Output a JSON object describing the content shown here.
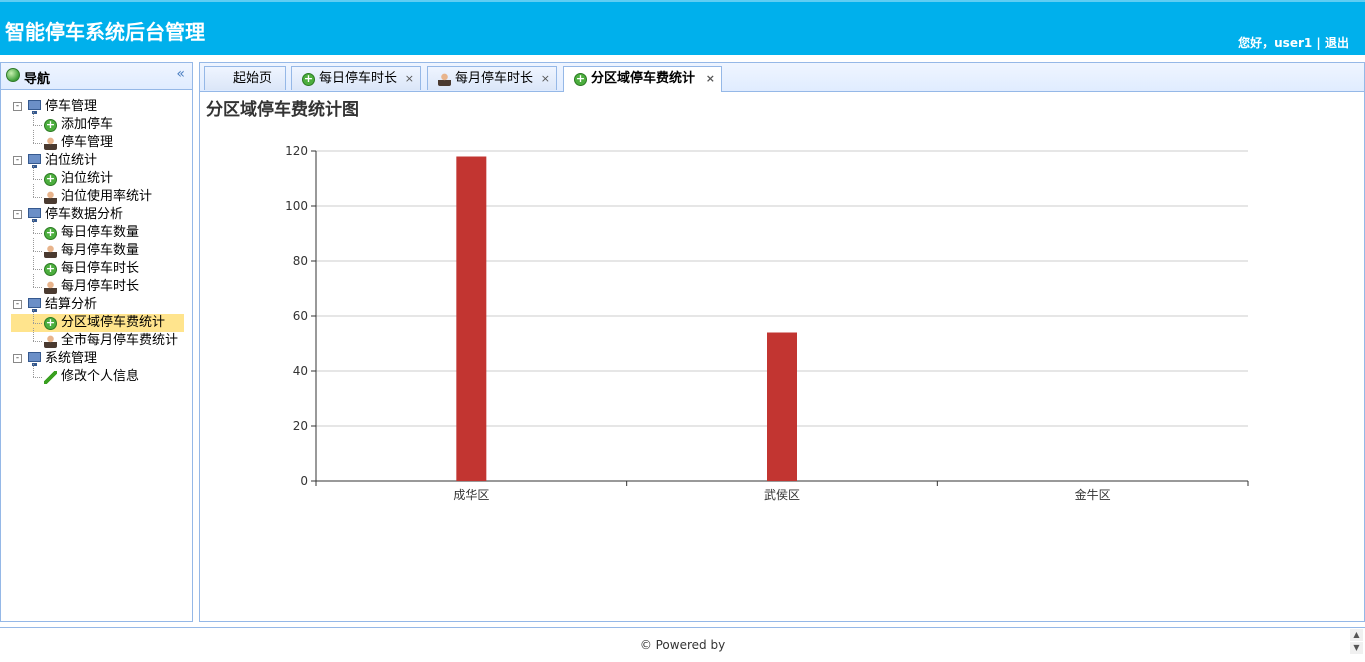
{
  "header": {
    "title": "智能停车系统后台管理",
    "greeting": "您好，user1",
    "separator": " | ",
    "logout": "退出"
  },
  "nav": {
    "title": "导航",
    "collapse_icon": "«",
    "groups": [
      {
        "label": "停车管理",
        "items": [
          {
            "label": "添加停车",
            "icon": "plus-icon"
          },
          {
            "label": "停车管理",
            "icon": "user-icon"
          }
        ]
      },
      {
        "label": "泊位统计",
        "items": [
          {
            "label": "泊位统计",
            "icon": "plus-icon"
          },
          {
            "label": "泊位使用率统计",
            "icon": "user-icon"
          }
        ]
      },
      {
        "label": "停车数据分析",
        "items": [
          {
            "label": "每日停车数量",
            "icon": "plus-icon"
          },
          {
            "label": "每月停车数量",
            "icon": "user-icon"
          },
          {
            "label": "每日停车时长",
            "icon": "plus-icon"
          },
          {
            "label": "每月停车时长",
            "icon": "user-icon"
          }
        ]
      },
      {
        "label": "结算分析",
        "items": [
          {
            "label": "分区域停车费统计",
            "icon": "plus-icon",
            "selected": true
          },
          {
            "label": "全市每月停车费统计",
            "icon": "user-icon"
          }
        ]
      },
      {
        "label": "系统管理",
        "items": [
          {
            "label": "修改个人信息",
            "icon": "pencil-icon"
          }
        ]
      }
    ]
  },
  "tabs": [
    {
      "label": "起始页",
      "closable": false,
      "icon": ""
    },
    {
      "label": "每日停车时长",
      "closable": true,
      "icon": "plus-icon"
    },
    {
      "label": "每月停车时长",
      "closable": true,
      "icon": "user-icon"
    },
    {
      "label": "分区域停车费统计",
      "closable": true,
      "icon": "plus-icon",
      "active": true
    }
  ],
  "tab_close_glyph": "×",
  "page_title": "分区域停车费统计图",
  "chart_data": {
    "type": "bar",
    "categories": [
      "成华区",
      "武侯区",
      "金牛区"
    ],
    "values": [
      118,
      54,
      0
    ],
    "ylim": [
      0,
      120
    ],
    "yticks": [
      0,
      20,
      40,
      60,
      80,
      100,
      120
    ],
    "grid": true,
    "bar_color": "#c23531"
  },
  "footer": {
    "text": "© Powered by"
  },
  "scroll": {
    "up": "▲",
    "down": "▼"
  }
}
